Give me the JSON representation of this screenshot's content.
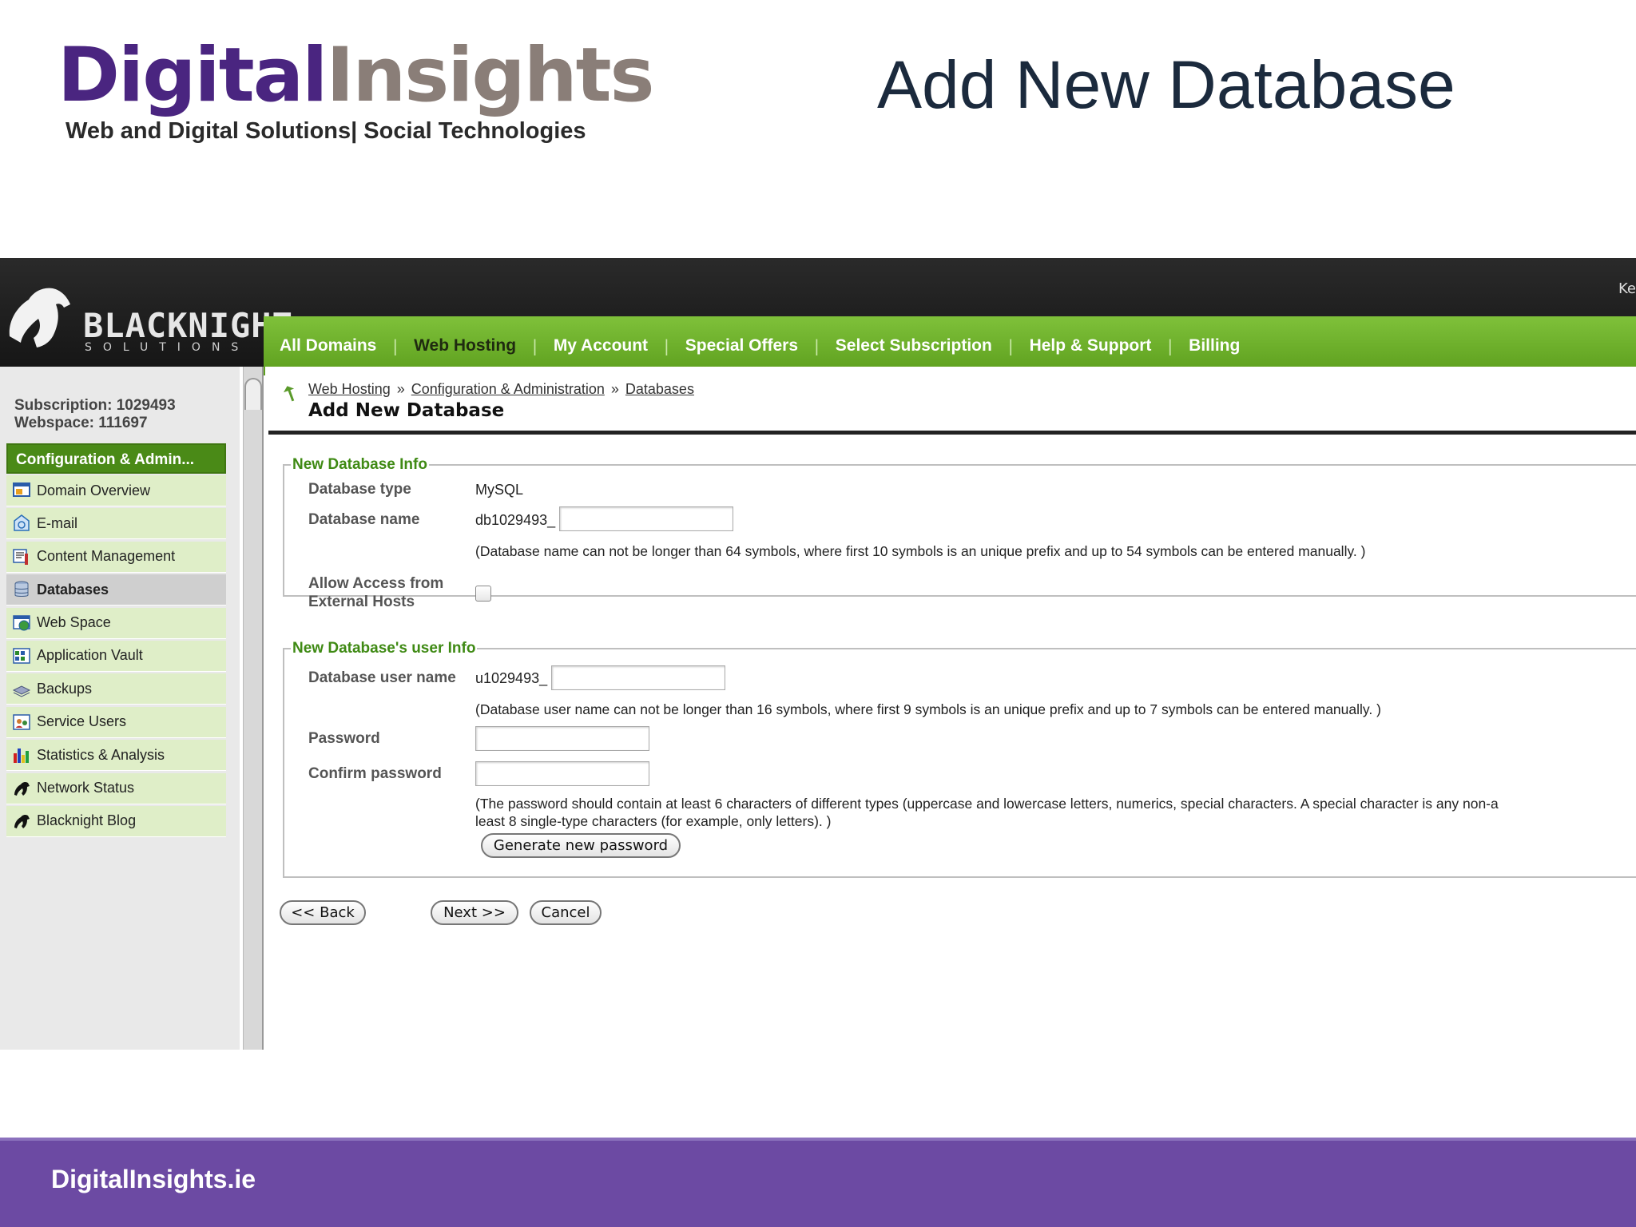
{
  "slide": {
    "logo_part1": "Digital",
    "logo_part2": "Insights",
    "logo_tagline": "Web and Digital Solutions| Social Technologies",
    "title": "Add New Database",
    "footer": "DigitalInsights.ie"
  },
  "header": {
    "brand": "BLACKNIGHT",
    "brand_sub": "SOLUTIONS",
    "user_fragment": "Ke"
  },
  "nav": {
    "items": [
      {
        "label": "All Domains"
      },
      {
        "label": "Web Hosting"
      },
      {
        "label": "My Account"
      },
      {
        "label": "Special Offers"
      },
      {
        "label": "Select Subscription"
      },
      {
        "label": "Help & Support"
      },
      {
        "label": "Billing"
      }
    ],
    "active": "Web Hosting"
  },
  "sidebar": {
    "subscription": "Subscription: 1029493",
    "webspace": "Webspace: 111697",
    "section_title": "Configuration & Admin...",
    "items": [
      {
        "label": "Domain Overview",
        "icon": "domain-overview-icon"
      },
      {
        "label": "E-mail",
        "icon": "email-icon"
      },
      {
        "label": "Content Management",
        "icon": "content-management-icon"
      },
      {
        "label": "Databases",
        "icon": "databases-icon"
      },
      {
        "label": "Web Space",
        "icon": "web-space-icon"
      },
      {
        "label": "Application Vault",
        "icon": "application-vault-icon"
      },
      {
        "label": "Backups",
        "icon": "backups-icon"
      },
      {
        "label": "Service Users",
        "icon": "service-users-icon"
      },
      {
        "label": "Statistics & Analysis",
        "icon": "statistics-icon"
      },
      {
        "label": "Network Status",
        "icon": "horse-icon"
      },
      {
        "label": "Blacknight Blog",
        "icon": "horse-icon"
      }
    ],
    "active": "Databases"
  },
  "main": {
    "breadcrumb": [
      "Web Hosting",
      "Configuration & Administration",
      "Databases"
    ],
    "breadcrumb_sep": "»",
    "title": "Add New Database",
    "db_info": {
      "legend": "New Database Info",
      "type_label": "Database type",
      "type_value": "MySQL",
      "name_label": "Database name",
      "name_prefix": "db1029493_",
      "name_value": "",
      "name_note": "(Database name can not be longer than 64 symbols, where first 10 symbols is an unique prefix and up to 54 symbols can be entered manually. )",
      "access_label_1": "Allow Access from",
      "access_label_2": "External Hosts",
      "access_checked": false
    },
    "user_info": {
      "legend": "New Database's user Info",
      "user_label": "Database user name",
      "user_prefix": "u1029493_",
      "user_value": "",
      "user_note": "(Database user name can not be longer than 16 symbols, where first 9 symbols is an unique prefix and up to 7 symbols can be entered manually. )",
      "password_label": "Password",
      "confirm_label": "Confirm password",
      "password_note_1": "(The password should contain at least 6 characters of different types (uppercase and lowercase letters, numerics, special characters. A special character is any non-a",
      "password_note_2": "least 8 single-type characters (for example, only letters). )",
      "generate_button": "Generate new password"
    },
    "buttons": {
      "back": "<< Back",
      "next": "Next >>",
      "cancel": "Cancel"
    }
  }
}
